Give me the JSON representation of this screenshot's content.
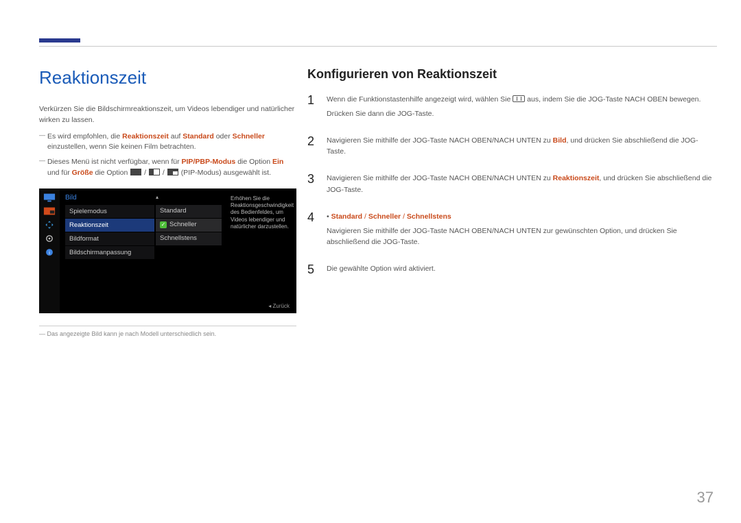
{
  "page_number": "37",
  "left": {
    "title": "Reaktionszeit",
    "intro": "Verkürzen Sie die Bildschirmreaktionszeit, um Videos lebendiger und natürlicher wirken zu lassen.",
    "note1_pre": "Es wird empfohlen, die ",
    "note1_hl1": "Reaktionszeit",
    "note1_mid": " auf ",
    "note1_hl2": "Standard",
    "note1_mid2": " oder ",
    "note1_hl3": "Schneller",
    "note1_post": " einzustellen, wenn Sie keinen Film betrachten.",
    "note2_pre": "Dieses Menü ist nicht verfügbar, wenn für ",
    "note2_hl1": "PIP/PBP-Modus",
    "note2_mid": " die Option ",
    "note2_hl2": "Ein",
    "note2_mid2": " und für ",
    "note2_hl3": "Größe",
    "note2_mid3": " die Option ",
    "note2_post": " (PIP-Modus) ausgewählt ist.",
    "footnote": "Das angezeigte Bild kann je nach Modell unterschiedlich sein."
  },
  "osd": {
    "header": "Bild",
    "items": [
      "Spielemodus",
      "Reaktionszeit",
      "Bildformat",
      "Bildschirmanpassung"
    ],
    "selected_index": 1,
    "sub_items": [
      "Standard",
      "Schneller",
      "Schnellstens"
    ],
    "sub_selected_index": 1,
    "tip": "Erhöhen Sie die Reaktionsgeschwindigkeit des Bedienfeldes, um Videos lebendiger und natürlicher darzustellen.",
    "back": "Zurück"
  },
  "right": {
    "title": "Konfigurieren von Reaktionszeit",
    "step1_a": "Wenn die Funktionstastenhilfe angezeigt wird, wählen Sie ",
    "step1_b": " aus, indem Sie die JOG-Taste NACH OBEN bewegen.",
    "step1_c": "Drücken Sie dann die JOG-Taste.",
    "step2_a": "Navigieren Sie mithilfe der JOG-Taste NACH OBEN/NACH UNTEN zu ",
    "step2_hl": "Bild",
    "step2_b": ", und drücken Sie abschließend die JOG-Taste.",
    "step3_a": "Navigieren Sie mithilfe der JOG-Taste NACH OBEN/NACH UNTEN zu ",
    "step3_hl": "Reaktionszeit",
    "step3_b": ", und drücken Sie abschließend die JOG-Taste.",
    "step4_opt1": "Standard",
    "step4_opt2": "Schneller",
    "step4_opt3": "Schnellstens",
    "step4_sep": " / ",
    "step4_a": "Navigieren Sie mithilfe der JOG-Taste NACH OBEN/NACH UNTEN zur gewünschten Option, und drücken Sie abschließend die JOG-Taste.",
    "step5": "Die gewählte Option wird aktiviert."
  }
}
